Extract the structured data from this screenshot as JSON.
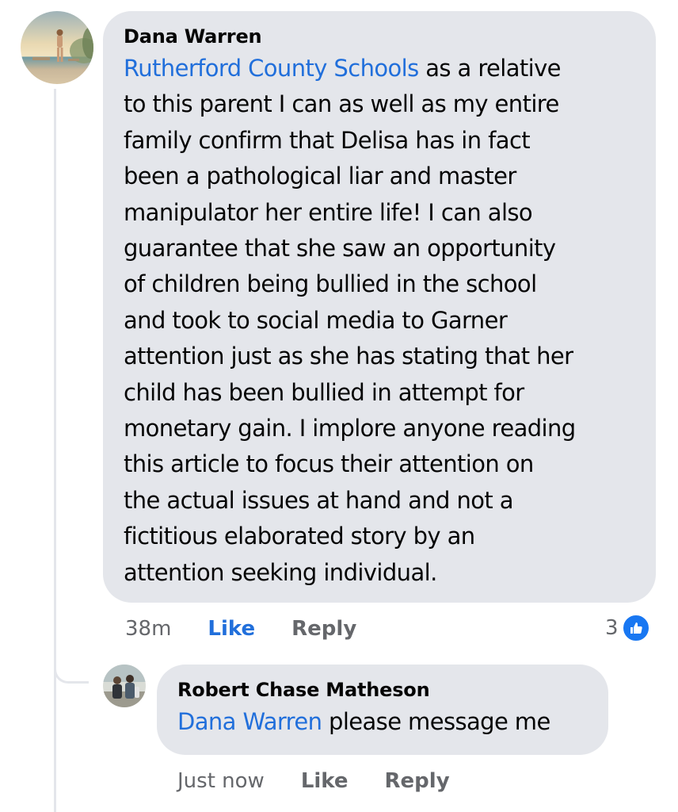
{
  "comment": {
    "author": "Dana Warren",
    "mention": "Rutherford County Schools",
    "text_lines": [
      " as a relative",
      "to this parent I can as well as my entire",
      "family confirm that Delisa  has in fact",
      "been a pathological liar and master",
      "manipulator her entire life! I can also",
      "guarantee that she saw an opportunity",
      "of children being bullied in the school",
      "and took to social media to Garner",
      "attention just as she has stating that her",
      "child has been bullied in attempt for",
      "monetary gain. I implore anyone reading",
      "this article to focus their attention on",
      "the actual issues at hand and not a",
      "fictitious elaborated story by an",
      "attention seeking individual."
    ],
    "time": "38m",
    "like_label": "Like",
    "reply_label": "Reply",
    "reaction_count": "3",
    "reaction_icon": "thumbs-up-icon",
    "like_color": "#216fdb"
  },
  "reply": {
    "author": "Robert Chase Matheson",
    "mention": "Dana Warren",
    "text": " please message me",
    "time": "Just now",
    "like_label": "Like",
    "reply_label": "Reply"
  },
  "colors": {
    "bubble": "#e4e6eb",
    "mention": "#216fdb",
    "meta": "#65676b",
    "like_badge": "#1877f2"
  }
}
